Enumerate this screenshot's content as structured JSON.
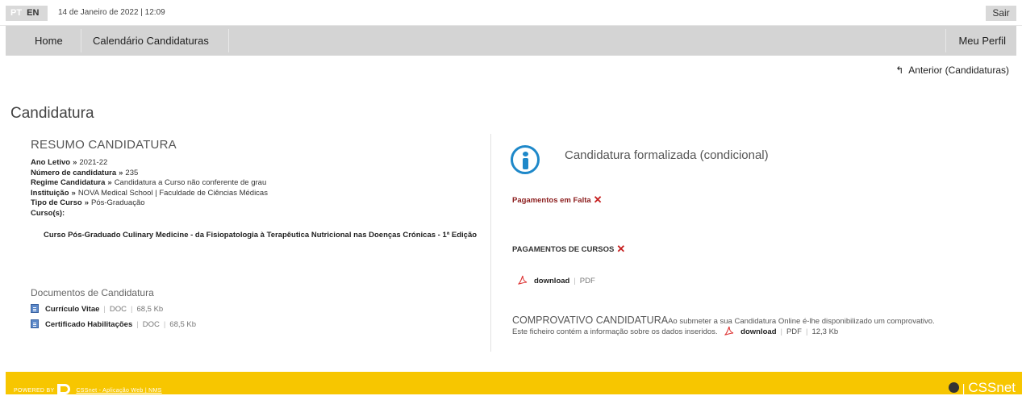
{
  "topbar": {
    "lang_pt": "PT",
    "lang_en": "EN",
    "datetime": "14 de Janeiro de 2022 | 12:09",
    "logout_label": "Sair"
  },
  "nav": {
    "items": [
      "Home",
      "Calendário Candidaturas"
    ],
    "profile_label": "Meu Perfil"
  },
  "back_link": "Anterior (Candidaturas)",
  "page_title": "Candidatura",
  "resumo": {
    "title": "RESUMO CANDIDATURA",
    "separator": "»",
    "fields": [
      {
        "label": "Ano Letivo",
        "value": "2021-22"
      },
      {
        "label": "Número de candidatura",
        "value": "235"
      },
      {
        "label": "Regime Candidatura",
        "value": "Candidatura a Curso não conferente de grau"
      },
      {
        "label": "Instituição",
        "value": "NOVA Medical School | Faculdade de Ciências Médicas"
      },
      {
        "label": "Tipo de Curso",
        "value": "Pós-Graduação"
      }
    ],
    "cursos_label": "Curso(s):",
    "curso_name": "Curso Pós-Graduado Culinary Medicine - da Fisiopatologia à Terapêutica Nutricional nas Doenças Crónicas - 1ª Edição"
  },
  "documentos": {
    "title": "Documentos de Candidatura",
    "items": [
      {
        "name": "Currículo Vitae",
        "type": "DOC",
        "size": "68,5 Kb"
      },
      {
        "name": "Certificado Habilitações",
        "type": "DOC",
        "size": "68,5 Kb"
      }
    ]
  },
  "status": {
    "message": "Candidatura formalizada (condicional)",
    "pagamentos_falta": "Pagamentos em Falta",
    "pagamentos_cursos": "PAGAMENTOS DE CURSOS",
    "download_label": "download",
    "download_type": "PDF"
  },
  "comprovativo": {
    "title": "COMPROVATIVO CANDIDATURA",
    "desc1": "Ao submeter a sua Candidatura Online é-lhe disponibilizado um comprovativo.",
    "desc2": "Este ficheiro contém a informação sobre os dados inseridos.",
    "download_label": "download",
    "type": "PDF",
    "size": "12,3 Kb"
  },
  "footer": {
    "powered_by": "POWERED BY",
    "link_text": "CSSnet - Aplicação Web | NMS",
    "brand": "CSSnet"
  },
  "colors": {
    "nav_bg": "#d4d4d4",
    "footer_bg": "#f7c600",
    "info_blue": "#1e88c9",
    "alert_red": "#c62020",
    "alert_text": "#8b1c1c"
  }
}
